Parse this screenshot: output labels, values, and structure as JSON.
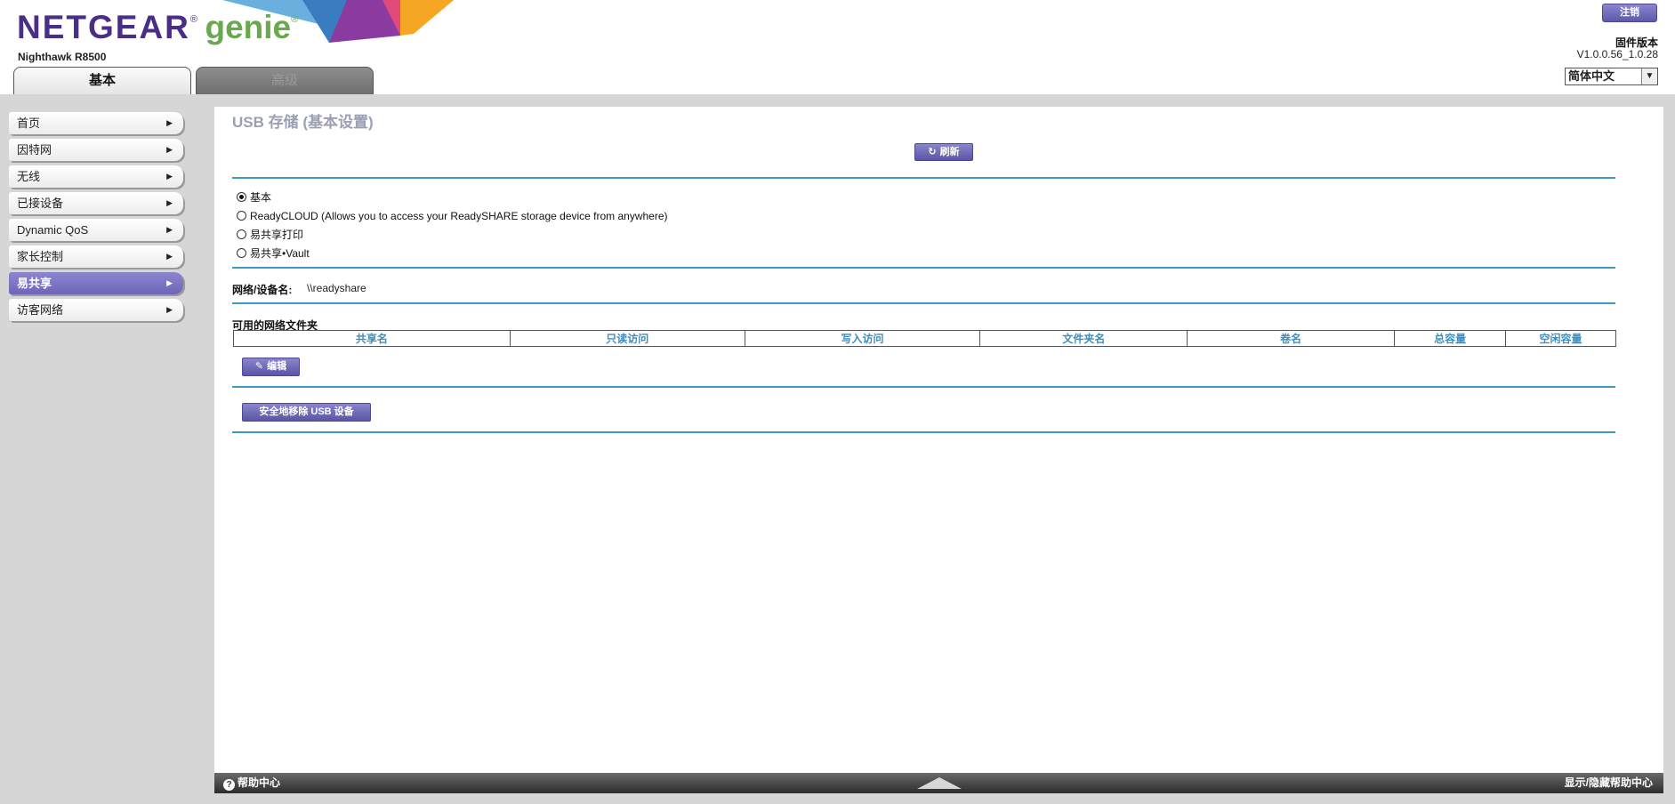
{
  "header": {
    "brand": "NETGEAR",
    "brand_mark": "®",
    "product": "genie",
    "product_mark": "®",
    "model": "Nighthawk R8500",
    "logout_label": "注销",
    "firmware_label": "固件版本",
    "firmware_version": "V1.0.0.56_1.0.28",
    "language": "简体中文",
    "accent_purple": "#4a2d87",
    "accent_green": "#6aa84f"
  },
  "tabs": [
    {
      "label": "基本",
      "active": true
    },
    {
      "label": "高级",
      "active": false
    }
  ],
  "sidebar": {
    "items": [
      {
        "label": "首页"
      },
      {
        "label": "因特网"
      },
      {
        "label": "无线"
      },
      {
        "label": "已接设备"
      },
      {
        "label": "Dynamic QoS"
      },
      {
        "label": "家长控制"
      },
      {
        "label": "易共享",
        "active": true
      },
      {
        "label": "访客网络"
      }
    ]
  },
  "main": {
    "title": "USB 存储 (基本设置)",
    "refresh_label": "刷新",
    "modes": [
      {
        "label": "基本",
        "selected": true
      },
      {
        "label": "ReadyCLOUD (Allows you to access your ReadySHARE storage device from anywhere)",
        "selected": false
      },
      {
        "label": "易共享打印",
        "selected": false
      },
      {
        "label": "易共享•Vault",
        "selected": false
      }
    ],
    "network_device_label": "网络/设备名:",
    "network_device_value": "\\\\readyshare",
    "folders_label": "可用的网络文件夹",
    "table_headers": [
      "共享名",
      "只读访问",
      "写入访问",
      "文件夹名",
      "卷名",
      "总容量",
      "空闲容量"
    ],
    "edit_label": "编辑",
    "eject_label": "安全地移除 USB 设备"
  },
  "footer": {
    "help_label": "帮助中心",
    "toggle_label": "显示/隐藏帮助中心"
  }
}
